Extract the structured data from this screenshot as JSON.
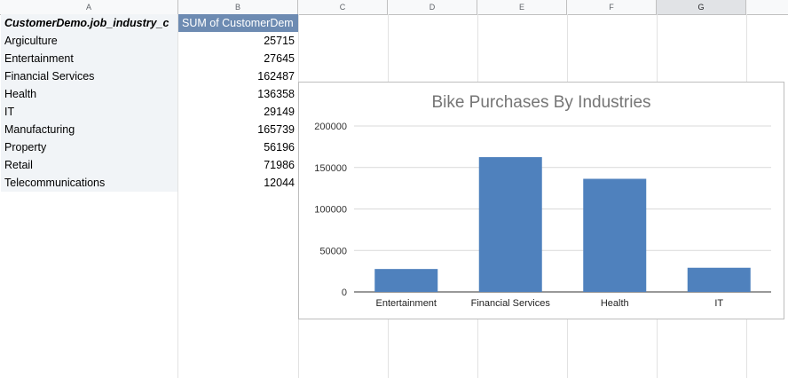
{
  "columns": [
    "A",
    "B",
    "C",
    "D",
    "E",
    "F",
    "G"
  ],
  "table": {
    "header_a": "CustomerDemo.job_industry_c",
    "header_b": "SUM of CustomerDem",
    "rows": [
      {
        "label": "Argiculture",
        "value": "25715"
      },
      {
        "label": "Entertainment",
        "value": "27645"
      },
      {
        "label": "Financial Services",
        "value": "162487"
      },
      {
        "label": "Health",
        "value": "136358"
      },
      {
        "label": "IT",
        "value": "29149"
      },
      {
        "label": "Manufacturing",
        "value": "165739"
      },
      {
        "label": "Property",
        "value": "56196"
      },
      {
        "label": "Retail",
        "value": "71986"
      },
      {
        "label": "Telecommunications",
        "value": "12044"
      }
    ]
  },
  "chart_data": {
    "type": "bar",
    "title": "Bike Purchases By Industries",
    "categories": [
      "Entertainment",
      "Financial Services",
      "Health",
      "IT"
    ],
    "values": [
      27645,
      162487,
      136358,
      29149
    ],
    "yticks": [
      "0",
      "50000",
      "100000",
      "150000",
      "200000"
    ],
    "ylim": [
      0,
      200000
    ],
    "grid": true,
    "bar_color": "#4f81bd"
  }
}
